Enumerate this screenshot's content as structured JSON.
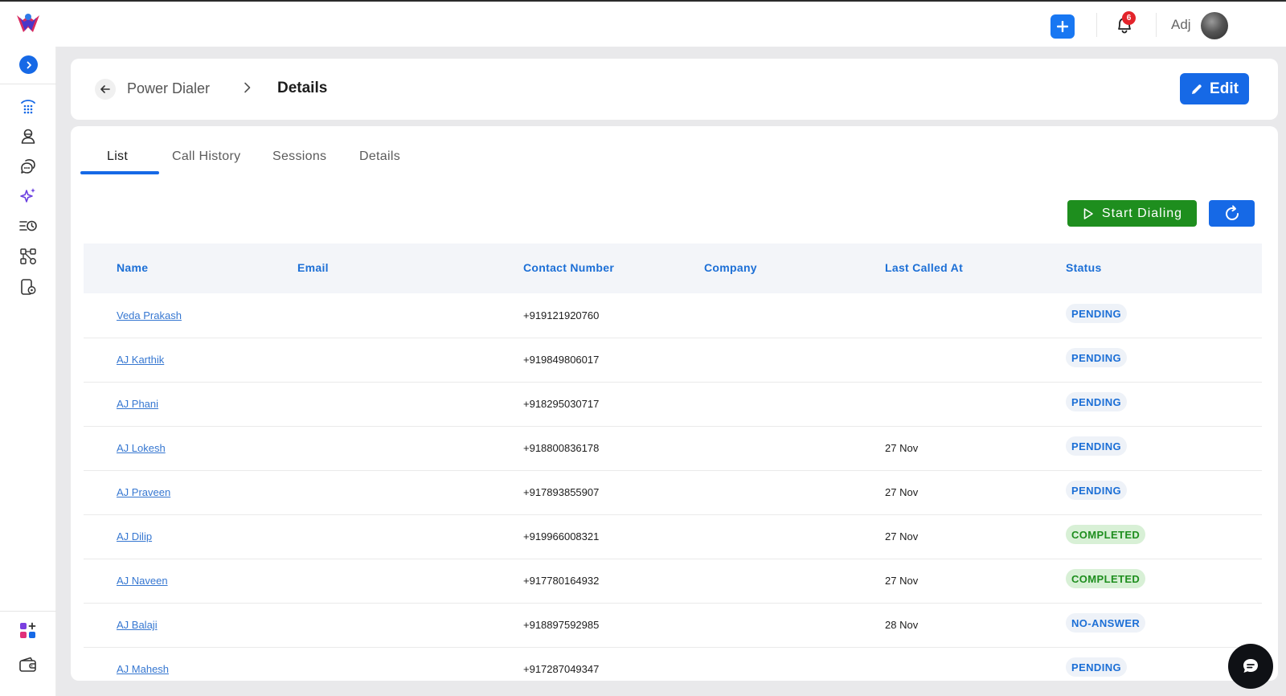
{
  "topbar": {
    "notifications_count": "6",
    "user_name": "Adj"
  },
  "header": {
    "breadcrumb_parent": "Power Dialer",
    "breadcrumb_current": "Details",
    "edit_label": "Edit"
  },
  "tabs": [
    {
      "label": "List",
      "active": true
    },
    {
      "label": "Call History",
      "active": false
    },
    {
      "label": "Sessions",
      "active": false
    },
    {
      "label": "Details",
      "active": false
    }
  ],
  "actions": {
    "start_dialing_label": "Start Dialing"
  },
  "table": {
    "columns": [
      "Name",
      "Email",
      "Contact Number",
      "Company",
      "Last Called At",
      "Status"
    ],
    "rows": [
      {
        "name": "Veda Prakash",
        "email": "",
        "contact": "+919121920760",
        "company": "",
        "last_called": "",
        "status": "PENDING"
      },
      {
        "name": "AJ Karthik",
        "email": "",
        "contact": "+919849806017",
        "company": "",
        "last_called": "",
        "status": "PENDING"
      },
      {
        "name": "AJ Phani",
        "email": "",
        "contact": "+918295030717",
        "company": "",
        "last_called": "",
        "status": "PENDING"
      },
      {
        "name": "AJ Lokesh",
        "email": "",
        "contact": "+918800836178",
        "company": "",
        "last_called": "27 Nov",
        "status": "PENDING"
      },
      {
        "name": "AJ Praveen",
        "email": "",
        "contact": "+917893855907",
        "company": "",
        "last_called": "27 Nov",
        "status": "PENDING"
      },
      {
        "name": "AJ Dilip",
        "email": "",
        "contact": "+919966008321",
        "company": "",
        "last_called": "27 Nov",
        "status": "COMPLETED"
      },
      {
        "name": "AJ Naveen",
        "email": "",
        "contact": "+917780164932",
        "company": "",
        "last_called": "27 Nov",
        "status": "COMPLETED"
      },
      {
        "name": "AJ Balaji",
        "email": "",
        "contact": "+918897592985",
        "company": "",
        "last_called": "28 Nov",
        "status": "NO-ANSWER"
      },
      {
        "name": "AJ Mahesh",
        "email": "",
        "contact": "+917287049347",
        "company": "",
        "last_called": "",
        "status": "PENDING"
      }
    ]
  },
  "sidebar": {
    "icons": [
      "dialpad-icon",
      "contacts-icon",
      "conversations-icon",
      "ai-sparkle-icon",
      "queue-history-icon",
      "workflow-icon",
      "device-settings-icon"
    ],
    "bottom_icons": [
      "apps-add-icon",
      "wallet-icon"
    ]
  },
  "colors": {
    "primary": "#1669e6",
    "success": "#1e8e1e",
    "badge_red": "#e3242b"
  }
}
